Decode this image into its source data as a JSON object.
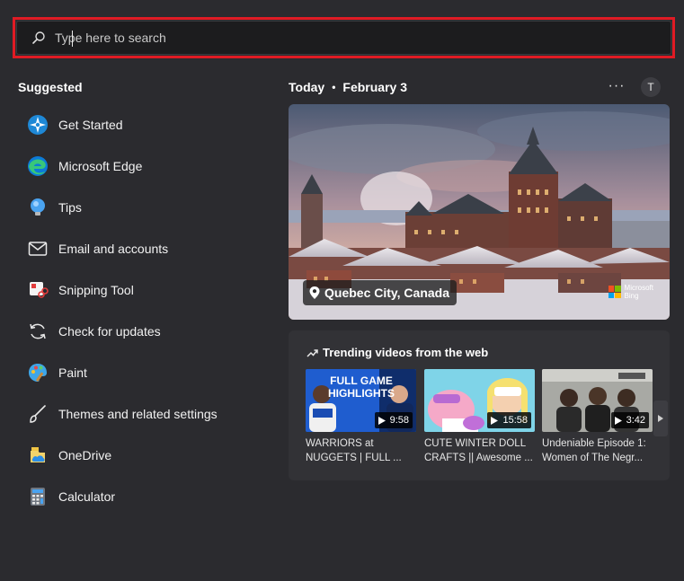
{
  "search": {
    "placeholder": "Type here to search",
    "value": ""
  },
  "suggested": {
    "title": "Suggested",
    "items": [
      {
        "label": "Get Started",
        "icon": "get-started-icon"
      },
      {
        "label": "Microsoft Edge",
        "icon": "edge-icon"
      },
      {
        "label": "Tips",
        "icon": "tips-icon"
      },
      {
        "label": "Email and accounts",
        "icon": "mail-icon"
      },
      {
        "label": "Snipping Tool",
        "icon": "snipping-tool-icon"
      },
      {
        "label": "Check for updates",
        "icon": "refresh-icon"
      },
      {
        "label": "Paint",
        "icon": "paint-icon"
      },
      {
        "label": "Themes and related settings",
        "icon": "brush-icon"
      },
      {
        "label": "OneDrive",
        "icon": "onedrive-icon"
      },
      {
        "label": "Calculator",
        "icon": "calculator-icon"
      }
    ]
  },
  "today": {
    "label": "Today",
    "separator": "•",
    "date": "February 3",
    "more": "···",
    "avatar_initial": "T"
  },
  "hero": {
    "location": "Quebec City, Canada",
    "brand_line1": "Microsoft",
    "brand_line2": "Bing"
  },
  "trending": {
    "title": "Trending videos from the web",
    "videos": [
      {
        "thumb_text": "FULL GAME HIGHLIGHTS",
        "duration": "9:58",
        "line1": "WARRIORS at",
        "line2": "NUGGETS | FULL ..."
      },
      {
        "duration": "15:58",
        "line1": "CUTE WINTER DOLL",
        "line2": "CRAFTS || Awesome ..."
      },
      {
        "duration": "3:42",
        "line1": "Undeniable Episode 1:",
        "line2": "Women of The Negr..."
      }
    ]
  },
  "colors": {
    "background": "#2b2b2f",
    "search_bg": "#1c1c1e",
    "highlight": "#e01b24",
    "card": "#323236"
  }
}
